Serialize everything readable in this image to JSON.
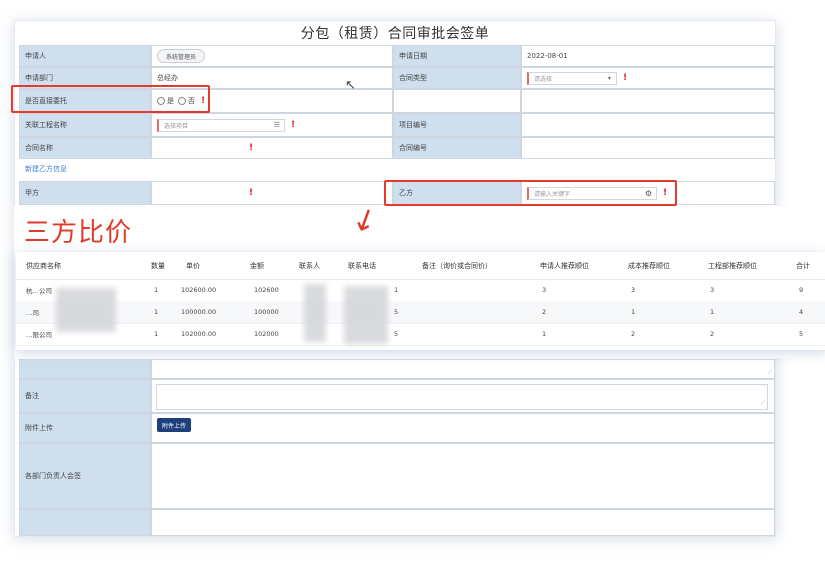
{
  "form": {
    "title": "分包（租赁）合同审批会签单",
    "applicant_label": "申请人",
    "applicant_value": "系统管理员",
    "apply_date_label": "申请日期",
    "apply_date_value": "2022-08-01",
    "dept_label": "申请部门",
    "dept_value": "总经办",
    "contract_type_label": "合同类型",
    "contract_type_placeholder": "请选择",
    "entrust_label": "是否直接委托",
    "entrust_yes": "是",
    "entrust_no": "否",
    "project_name_label": "关联工程名称",
    "project_name_placeholder": "选择项目",
    "project_no_label": "项目编号",
    "contract_name_label": "合同名称",
    "contract_no_label": "合同编号",
    "new_party_link": "新建乙方信息",
    "party_a_label": "甲方",
    "party_b_label": "乙方",
    "party_b_placeholder": "请输入关键字",
    "remark_label": "备注",
    "upload_label": "附件上传",
    "upload_button": "附件上传",
    "sign_label": "各部门负责人会签",
    "required_mark": "!"
  },
  "overlay": {
    "title": "三方比价",
    "arrow": "↓"
  },
  "comparison": {
    "headers": [
      "供应商名称",
      "数量",
      "单价",
      "金额",
      "联系人",
      "联系电话",
      "备注（询价或合同价）",
      "申请人推荐顺位",
      "成本推荐顺位",
      "工程部推荐顺位",
      "合计"
    ],
    "rows": [
      {
        "supplier": "杭…公司",
        "qty": "1",
        "price": "102600.00",
        "amount": "102600",
        "contact": "",
        "phone": "1",
        "note": "",
        "r1": "3",
        "r2": "3",
        "r3": "3",
        "total": "9"
      },
      {
        "supplier": "…司",
        "qty": "1",
        "price": "100000.00",
        "amount": "100000",
        "contact": "",
        "phone": "5",
        "note": "",
        "r1": "2",
        "r2": "1",
        "r3": "1",
        "total": "4"
      },
      {
        "supplier": "…限公司",
        "qty": "1",
        "price": "102000.00",
        "amount": "102000",
        "contact": "",
        "phone": "5",
        "note": "",
        "r1": "1",
        "r2": "2",
        "r3": "2",
        "total": "5"
      }
    ]
  },
  "colors": {
    "label_bg": "#cfdfee",
    "highlight": "#e53a2e",
    "link": "#3a7fd5",
    "upload_btn": "#1f3f7a"
  }
}
